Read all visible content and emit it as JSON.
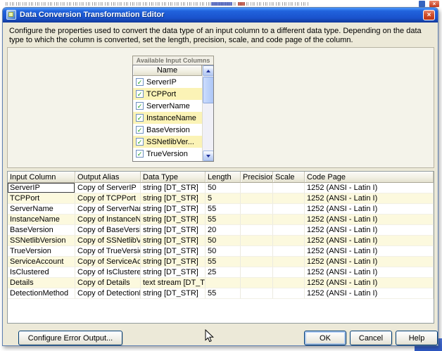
{
  "titlebar": {
    "title": "Data Conversion Transformation Editor"
  },
  "description": "Configure the properties used to convert the data type of an input column to a different data type. Depending on the data type to which the column is converted, set the length, precision, scale, and code page of the column.",
  "available_columns": {
    "caption": "Available Input Columns",
    "name_header": "Name",
    "items": [
      {
        "label": "ServerIP",
        "checked": true
      },
      {
        "label": "TCPPort",
        "checked": true
      },
      {
        "label": "ServerName",
        "checked": true
      },
      {
        "label": "InstanceName",
        "checked": true
      },
      {
        "label": "BaseVersion",
        "checked": true
      },
      {
        "label": "SSNetlibVer...",
        "checked": true
      },
      {
        "label": "TrueVersion",
        "checked": true
      }
    ]
  },
  "grid": {
    "columns": [
      "Input Column",
      "Output Alias",
      "Data Type",
      "Length",
      "Precision",
      "Scale",
      "Code Page"
    ],
    "rows": [
      {
        "input": "ServerIP",
        "alias": "Copy of ServerIP",
        "type": "string [DT_STR]",
        "length": "50",
        "precision": "",
        "scale": "",
        "codepage": "1252 (ANSI - Latin I)"
      },
      {
        "input": "TCPPort",
        "alias": "Copy of TCPPort",
        "type": "string [DT_STR]",
        "length": "5",
        "precision": "",
        "scale": "",
        "codepage": "1252 (ANSI - Latin I)"
      },
      {
        "input": "ServerName",
        "alias": "Copy of ServerName",
        "type": "string [DT_STR]",
        "length": "55",
        "precision": "",
        "scale": "",
        "codepage": "1252 (ANSI - Latin I)"
      },
      {
        "input": "InstanceName",
        "alias": "Copy of InstanceNa...",
        "type": "string [DT_STR]",
        "length": "55",
        "precision": "",
        "scale": "",
        "codepage": "1252 (ANSI - Latin I)"
      },
      {
        "input": "BaseVersion",
        "alias": "Copy of BaseVersion",
        "type": "string [DT_STR]",
        "length": "20",
        "precision": "",
        "scale": "",
        "codepage": "1252 (ANSI - Latin I)"
      },
      {
        "input": "SSNetlibVersion",
        "alias": "Copy of SSNetlibVer...",
        "type": "string [DT_STR]",
        "length": "50",
        "precision": "",
        "scale": "",
        "codepage": "1252 (ANSI - Latin I)"
      },
      {
        "input": "TrueVersion",
        "alias": "Copy of TrueVersion",
        "type": "string [DT_STR]",
        "length": "50",
        "precision": "",
        "scale": "",
        "codepage": "1252 (ANSI - Latin I)"
      },
      {
        "input": "ServiceAccount",
        "alias": "Copy of ServiceAcc...",
        "type": "string [DT_STR]",
        "length": "55",
        "precision": "",
        "scale": "",
        "codepage": "1252 (ANSI - Latin I)"
      },
      {
        "input": "IsClustered",
        "alias": "Copy of IsClustered",
        "type": "string [DT_STR]",
        "length": "25",
        "precision": "",
        "scale": "",
        "codepage": "1252 (ANSI - Latin I)"
      },
      {
        "input": "Details",
        "alias": "Copy of Details",
        "type": "text stream [DT_TEXT]",
        "length": "",
        "precision": "",
        "scale": "",
        "codepage": "1252 (ANSI - Latin I)"
      },
      {
        "input": "DetectionMethod",
        "alias": "Copy of DetectionM...",
        "type": "string [DT_STR]",
        "length": "55",
        "precision": "",
        "scale": "",
        "codepage": "1252 (ANSI - Latin I)"
      }
    ]
  },
  "buttons": {
    "configure_error_output": "Configure Error Output...",
    "ok": "OK",
    "cancel": "Cancel",
    "help": "Help"
  }
}
